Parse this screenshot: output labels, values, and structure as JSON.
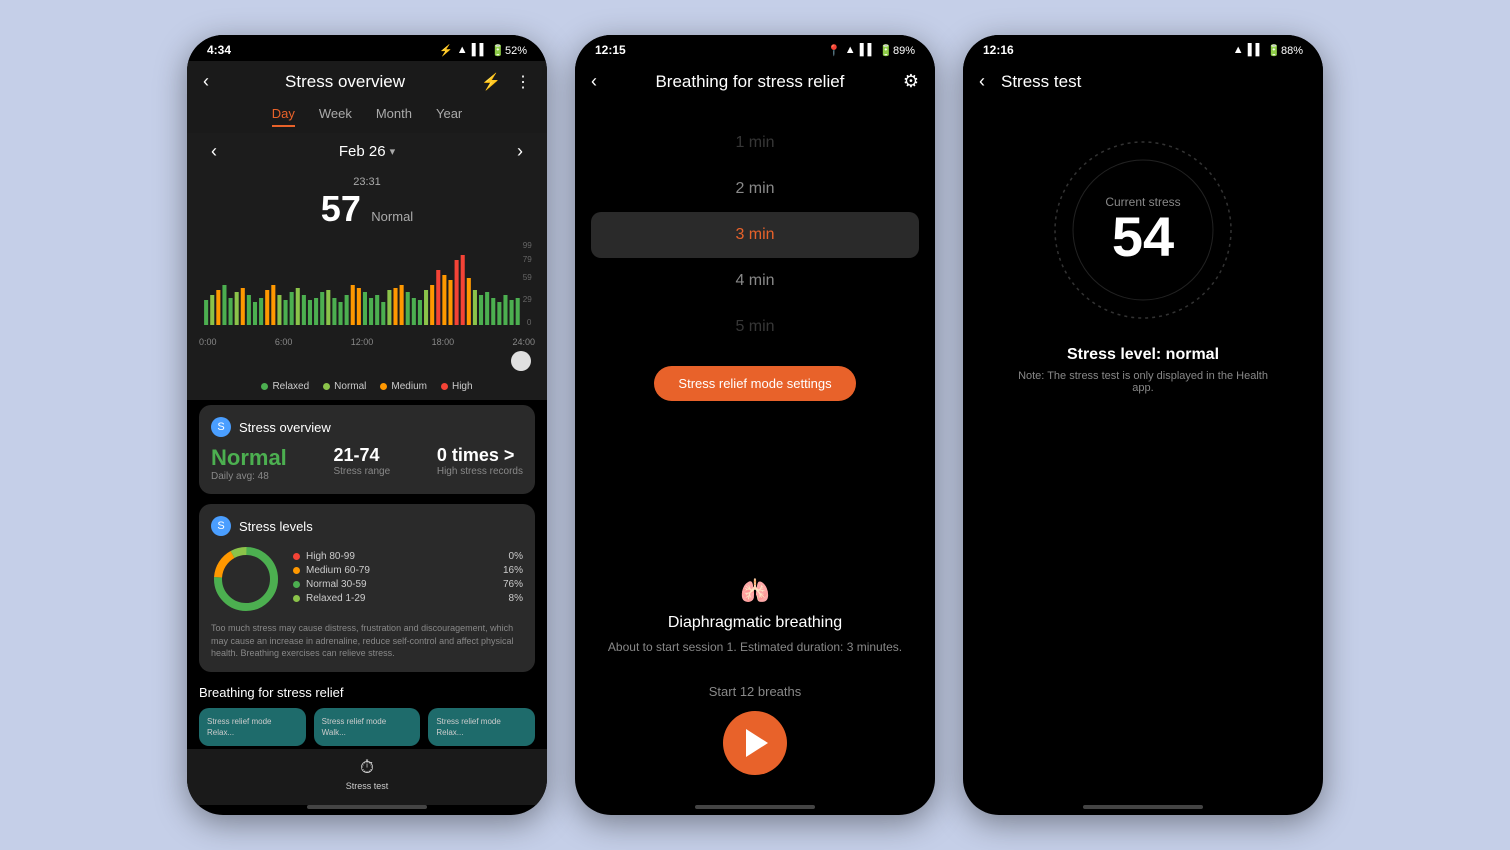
{
  "bg": "#c5cfe8",
  "phones": [
    {
      "id": "stress-overview",
      "status": {
        "time": "4:34",
        "icons": "bluetooth wifi signal battery 52%"
      },
      "header": {
        "back": "‹",
        "title": "Stress overview",
        "icon1": "⚡",
        "icon2": "⋮"
      },
      "tabs": [
        "Day",
        "Week",
        "Month",
        "Year"
      ],
      "active_tab": "Day",
      "date": "Feb 26",
      "stress_time": "23:31",
      "stress_value": "57",
      "stress_status": "Normal",
      "chart_x_labels": [
        "0:00",
        "6:00",
        "12:00",
        "18:00",
        "24:00"
      ],
      "chart_y_labels": [
        "99",
        "79",
        "59",
        "29",
        "0"
      ],
      "legend": [
        {
          "label": "Relaxed",
          "color": "#4caf50"
        },
        {
          "label": "Normal",
          "color": "#8bc34a"
        },
        {
          "label": "Medium",
          "color": "#ff9800"
        },
        {
          "label": "High",
          "color": "#f44336"
        }
      ],
      "overview_card": {
        "title": "Stress overview",
        "normal_label": "Normal",
        "daily_avg": "Daily avg: 48",
        "range": "21-74",
        "range_label": "Stress range",
        "high": "0 times >",
        "high_label": "High stress records"
      },
      "levels_card": {
        "title": "Stress levels",
        "levels": [
          {
            "label": "High 80-99",
            "color": "#f44336",
            "pct": "0%"
          },
          {
            "label": "Medium 60-79",
            "color": "#ff9800",
            "pct": "16%"
          },
          {
            "label": "Normal 30-59",
            "color": "#4caf50",
            "pct": "76%"
          },
          {
            "label": "Relaxed 1-29",
            "color": "#8bc34a",
            "pct": "8%"
          }
        ],
        "note": "Too much stress may cause distress, frustration and discouragement, which may cause an increase in adrenaline, reduce self-control and affect physical health. Breathing exercises can relieve stress."
      },
      "breathing_section": {
        "title": "Breathing for stress relief",
        "cards": [
          "Stress relief mode\nRelax...",
          "Stress relief mode\nWalk...",
          "Stress relief mode\nRelax..."
        ]
      },
      "bottom_nav": {
        "icon": "⏱",
        "label": "Stress test"
      }
    },
    {
      "id": "breathing",
      "status": {
        "time": "12:15",
        "icons": "location wifi signal battery 89%"
      },
      "header": {
        "back": "‹",
        "title": "Breathing for stress relief",
        "gear": "⚙"
      },
      "duration_items": [
        {
          "label": "1 min",
          "selected": false,
          "faded": true
        },
        {
          "label": "2 min",
          "selected": false,
          "faded": false
        },
        {
          "label": "3 min",
          "selected": true,
          "faded": false
        },
        {
          "label": "4 min",
          "selected": false,
          "faded": false
        },
        {
          "label": "5 min",
          "selected": false,
          "faded": true
        }
      ],
      "settings_btn": "Stress relief mode settings",
      "breathing_info": {
        "icon": "🫁",
        "title": "Diaphragmatic breathing",
        "subtitle": "About to start session 1. Estimated duration: 3 minutes."
      },
      "play_section": {
        "start_label": "Start 12 breaths"
      }
    },
    {
      "id": "stress-test",
      "status": {
        "time": "12:16",
        "icons": "wifi signal battery 88%"
      },
      "header": {
        "back": "‹",
        "title": "Stress test"
      },
      "gauge": {
        "current_label": "Current stress",
        "value": "54"
      },
      "stress_level": "Stress level: normal",
      "stress_note": "Note: The stress test is only displayed in the Health app."
    }
  ]
}
